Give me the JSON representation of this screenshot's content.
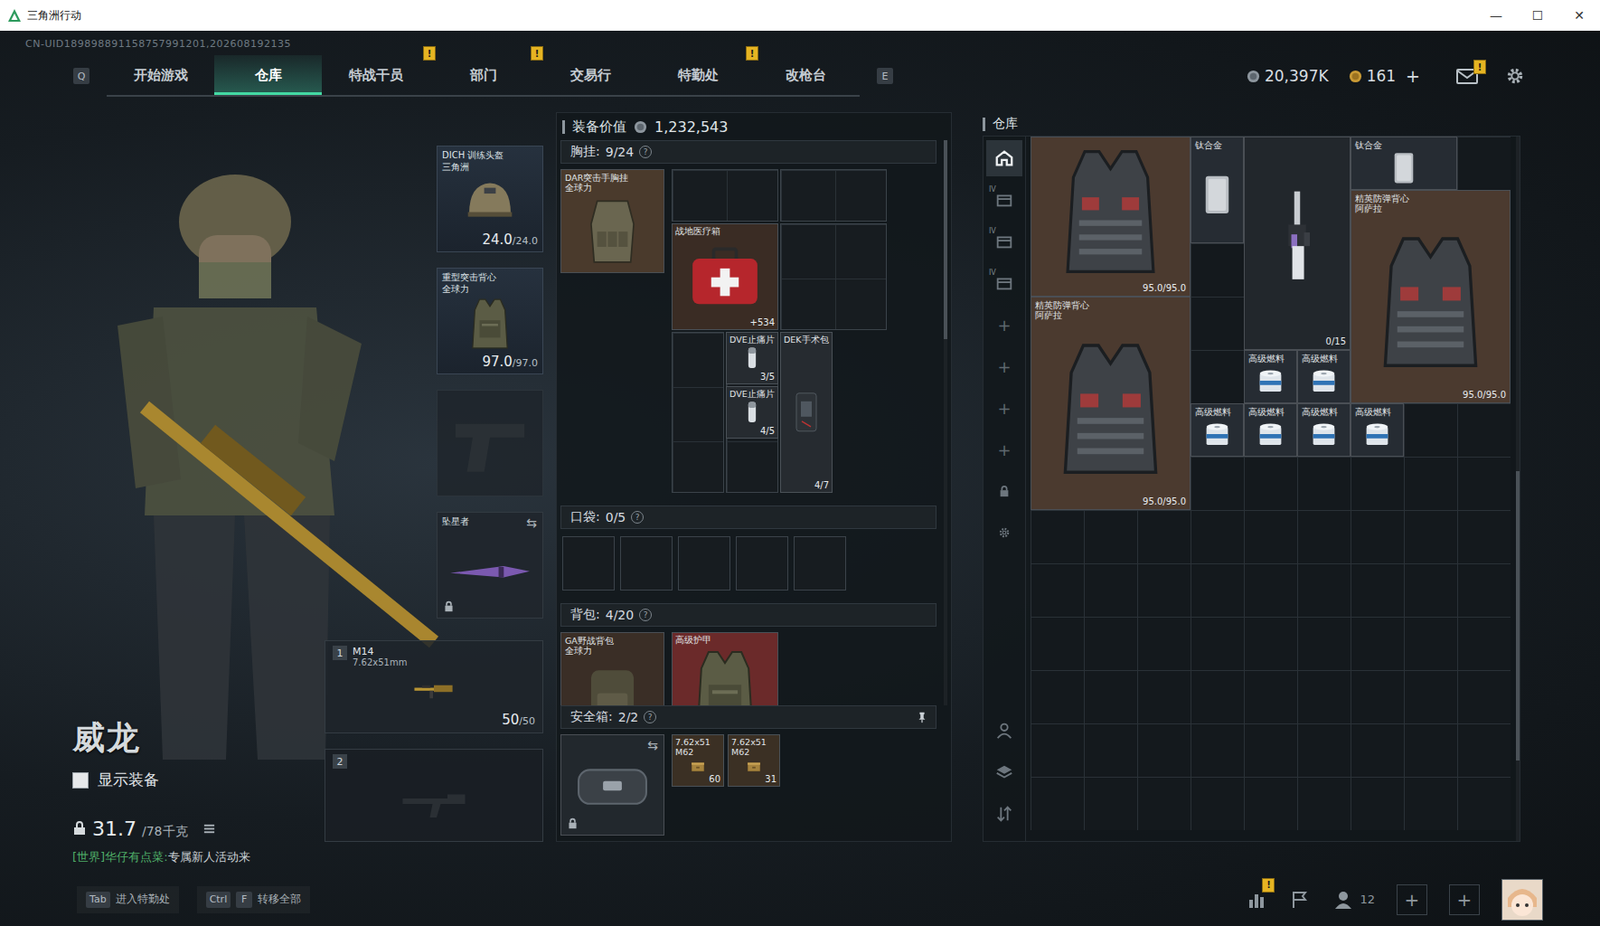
{
  "window": {
    "title": "三角洲行动",
    "controls": [
      "—",
      "☐",
      "✕"
    ]
  },
  "uid": "CN-UID189898891158757991201,202608192135",
  "nav": {
    "left_key": "Q",
    "right_key": "E",
    "tabs": [
      {
        "label": "开始游戏",
        "selected": false,
        "badge": ""
      },
      {
        "label": "仓库",
        "selected": true,
        "badge": ""
      },
      {
        "label": "特战干员",
        "selected": false,
        "badge": "!"
      },
      {
        "label": "部门",
        "selected": false,
        "badge": "!"
      },
      {
        "label": "交易行",
        "selected": false,
        "badge": ""
      },
      {
        "label": "特勤处",
        "selected": false,
        "badge": "!"
      },
      {
        "label": "改枪台",
        "selected": false,
        "badge": ""
      }
    ]
  },
  "currency": {
    "coins": "20,397K",
    "tokens": "161",
    "add": "+",
    "mail_badge": "!"
  },
  "character": {
    "name": "威龙",
    "show_equipment": {
      "label": "显示装备",
      "checked": false
    },
    "weight": "31.7",
    "capacity": "/78千克",
    "chat": {
      "channel": "[世界]",
      "sender": "华仔有点菜:",
      "message": "专属新人活动来"
    }
  },
  "equipment": {
    "slots": [
      {
        "kind": "helmet",
        "name": "DICH 训练头盔",
        "sub": "三角洲",
        "value": "24.0",
        "max": "/24.0",
        "locked": false,
        "swap": ""
      },
      {
        "kind": "armor",
        "name": "重型突击背心",
        "sub": "全球力",
        "value": "97.0",
        "max": "/97.0",
        "locked": false,
        "swap": ""
      },
      {
        "kind": "pistol",
        "name": "",
        "sub": "",
        "value": "",
        "max": "",
        "locked": false,
        "swap": ""
      },
      {
        "kind": "knife",
        "name": "坠星者",
        "sub": "",
        "value": "",
        "max": "",
        "locked": true,
        "swap": "⇆"
      }
    ],
    "weapons": [
      {
        "slot": "1",
        "name": "M14",
        "caliber": "7.62x51mm",
        "ammo": "50",
        "max": "/50",
        "empty": false
      },
      {
        "slot": "2",
        "name": "",
        "caliber": "",
        "ammo": "",
        "max": "",
        "empty": true
      }
    ]
  },
  "loadout": {
    "value_label": "装备价值",
    "value": "1,232,543",
    "chest": {
      "label": "胸挂:",
      "count": "9/24",
      "help": "?",
      "rig": {
        "name": "DAR突击手胸挂",
        "sub": "全球力",
        "color": "#4a3a2c"
      },
      "items": [
        {
          "kind": "medkit",
          "name": "战地医疗箱",
          "count": "+534",
          "color": "#3a2c24"
        },
        {
          "kind": "pill",
          "name": "DVE止痛片",
          "count": "3/5",
          "color": "#262b30"
        },
        {
          "kind": "pill",
          "name": "DVE止痛片",
          "count": "4/5",
          "color": "#262b30"
        },
        {
          "kind": "surgery",
          "name": "DEK手术包",
          "count": "4/7",
          "color": "#262b30"
        }
      ]
    },
    "pocket": {
      "label": "口袋:",
      "count": "0/5",
      "help": "?"
    },
    "backpack": {
      "label": "背包:",
      "count": "4/20",
      "help": "?",
      "bag": {
        "name": "GA野战背包",
        "sub": "全球力",
        "color": "#3a2e26"
      },
      "items": [
        {
          "kind": "armor",
          "name": "高级护甲",
          "color": "#6b2a2a"
        }
      ]
    },
    "safe": {
      "label": "安全箱:",
      "count": "2/2",
      "help": "?",
      "locked": true,
      "swap": "⇆",
      "items": [
        {
          "kind": "ammo",
          "name": "7.62x51 M62",
          "count": "60",
          "color": "#3b3024"
        },
        {
          "kind": "ammo",
          "name": "7.62x51 M62",
          "count": "31",
          "color": "#3b3024"
        }
      ]
    }
  },
  "warehouse": {
    "title": "仓库",
    "sidebar": [
      {
        "kind": "tab",
        "glyph": "",
        "selected": true
      },
      {
        "kind": "tab",
        "glyph": "IV",
        "selected": false
      },
      {
        "kind": "tab",
        "glyph": "IV",
        "selected": false
      },
      {
        "kind": "tab",
        "glyph": "IV",
        "selected": false
      },
      {
        "kind": "add",
        "glyph": "+",
        "selected": false
      },
      {
        "kind": "add",
        "glyph": "+",
        "selected": false
      },
      {
        "kind": "add",
        "glyph": "+",
        "selected": false
      },
      {
        "kind": "add",
        "glyph": "+",
        "selected": false
      },
      {
        "kind": "lock",
        "glyph": "",
        "selected": false
      },
      {
        "kind": "settings",
        "glyph": "",
        "selected": false
      }
    ],
    "tools": [
      {
        "kind": "loadout"
      },
      {
        "kind": "layers"
      },
      {
        "kind": "sort"
      }
    ],
    "items": [
      {
        "kind": "vest",
        "name": "",
        "sub": "",
        "durability": "95.0/95.0",
        "color": "#4b3a2f"
      },
      {
        "kind": "plate",
        "name": "钛合金",
        "sub": "",
        "durability": "",
        "color": "#262c33"
      },
      {
        "kind": "rifle",
        "name": "",
        "sub": "",
        "durability": "0/15",
        "color": "#22272c"
      },
      {
        "kind": "plate",
        "name": "钛合金",
        "sub": "",
        "durability": "",
        "color": "#262c33"
      },
      {
        "kind": "vest",
        "name": "精英防弹背心",
        "sub": "阿萨拉",
        "durability": "95.0/95.0",
        "color": "#4b3a2f"
      },
      {
        "kind": "vest",
        "name": "精英防弹背心",
        "sub": "阿萨拉",
        "durability": "95.0/95.0",
        "color": "#4b3a2f"
      },
      {
        "kind": "fuel",
        "name": "高级燃料",
        "sub": "",
        "durability": "",
        "color": "#262c33"
      },
      {
        "kind": "fuel",
        "name": "高级燃料",
        "sub": "",
        "durability": "",
        "color": "#262c33"
      },
      {
        "kind": "fuel",
        "name": "高级燃料",
        "sub": "",
        "durability": "",
        "color": "#262c33"
      },
      {
        "kind": "fuel",
        "name": "高级燃料",
        "sub": "",
        "durability": "",
        "color": "#262c33"
      },
      {
        "kind": "fuel",
        "name": "高级燃料",
        "sub": "",
        "durability": "",
        "color": "#262c33"
      },
      {
        "kind": "fuel",
        "name": "高级燃料",
        "sub": "",
        "durability": "",
        "color": "#262c33"
      }
    ]
  },
  "bottom": {
    "hints": [
      {
        "keys": [
          "Tab"
        ],
        "label": "进入特勤处"
      },
      {
        "keys": [
          "Ctrl",
          "F"
        ],
        "label": "转移全部"
      }
    ],
    "stats_badge": "!",
    "friends": "12",
    "slots": [
      "+",
      "+"
    ]
  }
}
